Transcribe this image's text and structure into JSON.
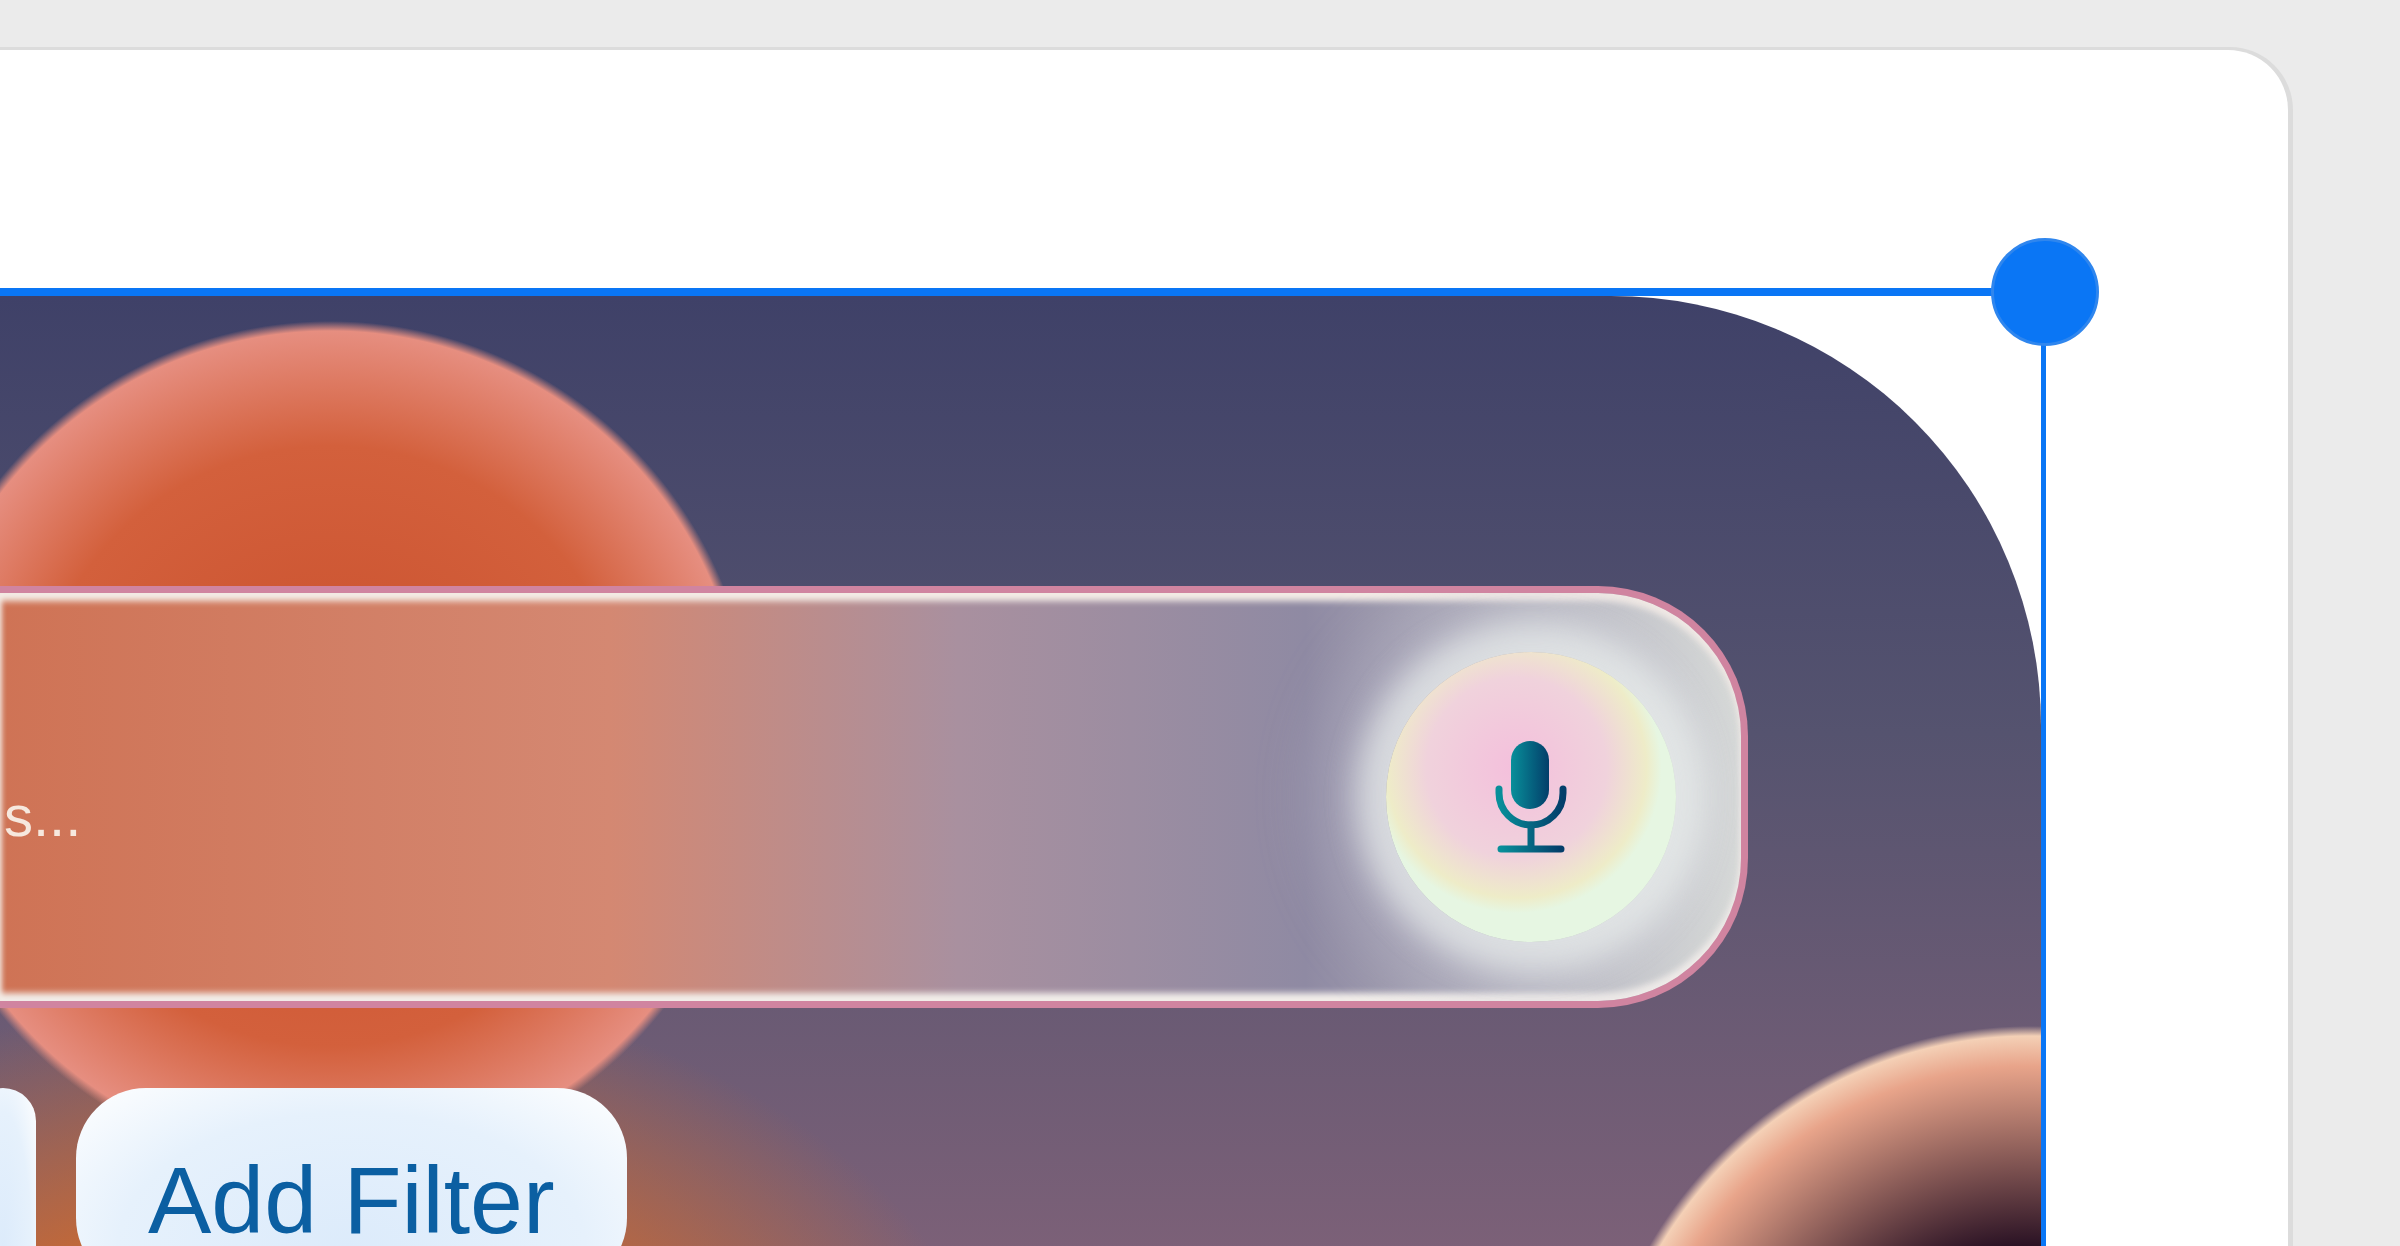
{
  "artboard": {
    "selected": true
  },
  "search": {
    "placeholder": "s..."
  },
  "filters": [
    {
      "label": "Add Filter"
    }
  ]
}
